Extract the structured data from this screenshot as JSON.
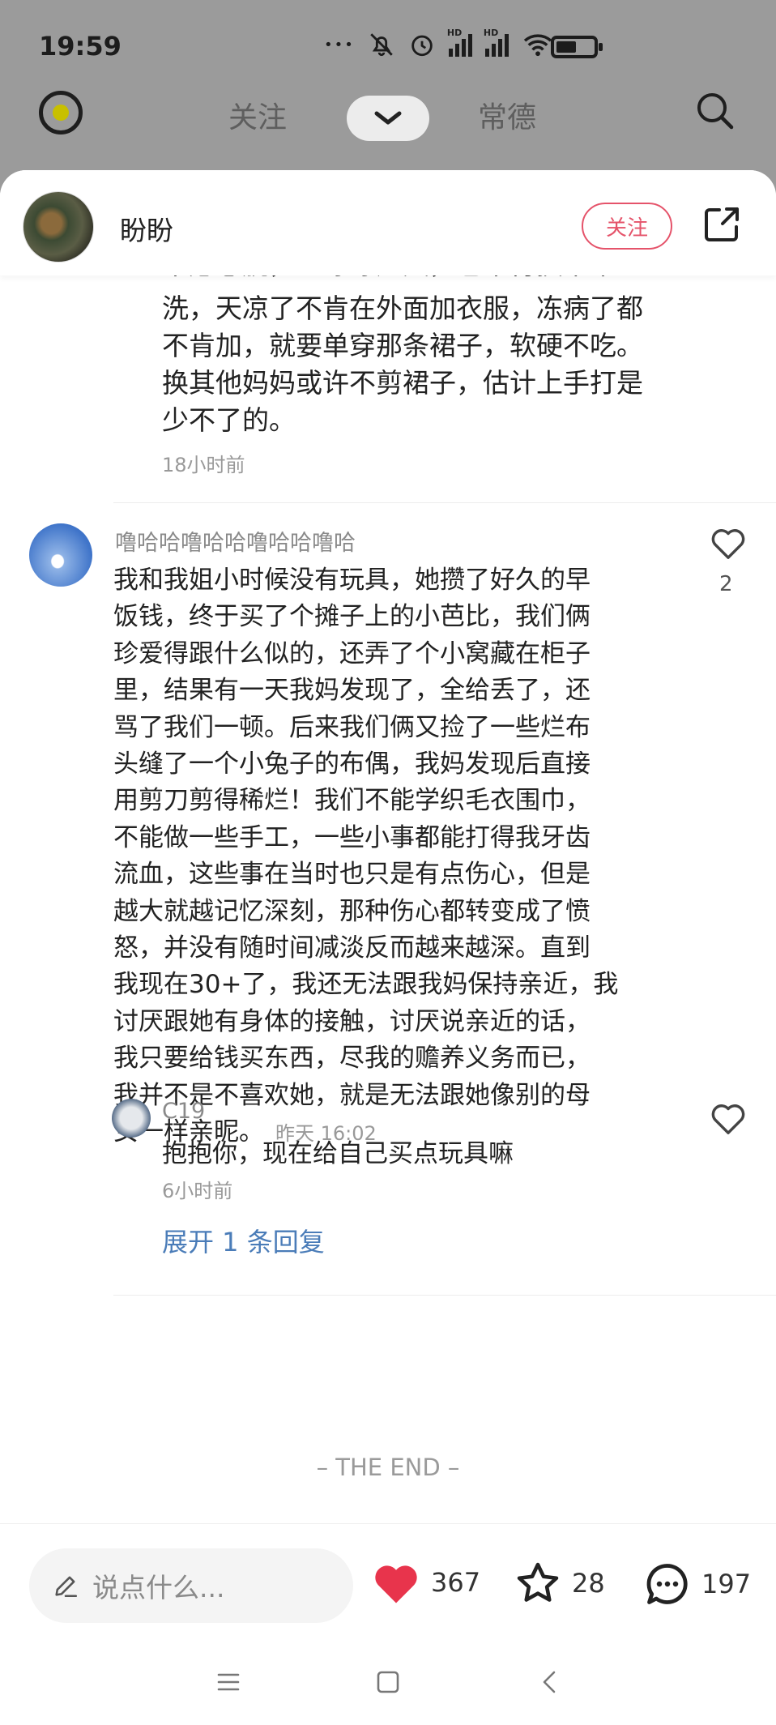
{
  "status_bar": {
    "time": "19:59",
    "hd_label": "HD",
    "more_dots": "•••"
  },
  "top_nav": {
    "tabs": [
      "关注",
      "常德"
    ]
  },
  "post": {
    "author": "盼盼",
    "follow_label": "关注"
  },
  "previous_comment": {
    "partial_top_line": "不愿意脱，一穿穿几天，也不肯换下来",
    "lines": [
      "洗，天凉了不肯在外面加衣服，冻病了都",
      "不肯加，就要单穿那条裙子，软硬不吃。",
      "换其他妈妈或许不剪裙子，估计上手打是",
      "少不了的。"
    ],
    "time": "18小时前"
  },
  "comment": {
    "user": "噜哈哈噜哈哈噜哈哈噜哈",
    "likes": "2",
    "lines": [
      "我和我姐小时候没有玩具，她攒了好久的早",
      "饭钱，终于买了个摊子上的小芭比，我们俩",
      "珍爱得跟什么似的，还弄了个小窝藏在柜子",
      "里，结果有一天我妈发现了，全给丢了，还",
      "骂了我们一顿。后来我们俩又捡了一些烂布",
      "头缝了一个小兔子的布偶，我妈发现后直接",
      "用剪刀剪得稀烂！我们不能学织毛衣围巾，",
      "不能做一些手工，一些小事都能打得我牙齿",
      "流血，这些事在当时也只是有点伤心，但是",
      "越大就越记忆深刻，那种伤心都转变成了愤",
      "怒，并没有随时间减淡反而越来越深。直到",
      "我现在30+了，我还无法跟我妈保持亲近，我",
      "讨厌跟她有身体的接触，讨厌说亲近的话，",
      "我只要给钱买东西，尽我的赡养义务而已，",
      "我并不是不喜欢她，就是无法跟她像别的母"
    ],
    "last_line": "女一样亲昵。",
    "time": "昨天 16:02"
  },
  "reply": {
    "user": "C19",
    "text": "抱抱你，现在给自己买点玩具嘛",
    "time": "6小时前",
    "expand_label": "展开 1 条回复"
  },
  "end_label": "– THE END –",
  "action_bar": {
    "input_placeholder": "说点什么...",
    "like_count": "367",
    "star_count": "28",
    "comment_count": "197",
    "like_color": "#e8344c"
  }
}
